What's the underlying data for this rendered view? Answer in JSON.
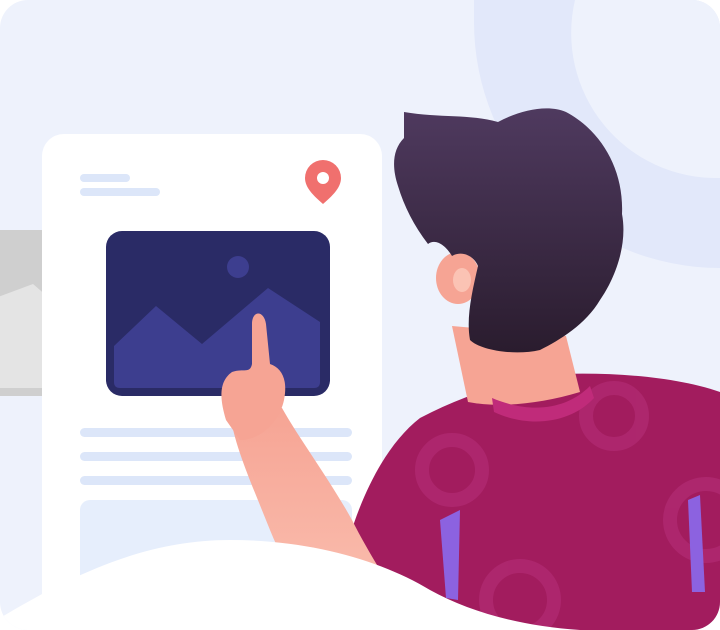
{
  "colors": {
    "background": "#EEF2FC",
    "decor_arc": "#E2E8FA",
    "card": "#FFFFFF",
    "placeholder_line": "#DCE6F9",
    "placeholder_block": "#E6EEFC",
    "side_card": "#CFCFCF",
    "side_card_icon": "#E4E4E4",
    "image_frame": "#2A2B66",
    "image_mountain": "#3D3E8F",
    "location_pin": "#F0706E",
    "skin": "#F6A494",
    "skin_light": "#FBC3B4",
    "hair_top": "#4F3A5F",
    "hair_bottom": "#2A1C2E",
    "shirt": "#A21C5E",
    "shirt_collar": "#C02B7A",
    "shirt_pattern": "#B6307A",
    "shirt_accent": "#8C62E0",
    "foreground_wave": "#FFFFFF"
  },
  "icons": {
    "location": "location-pin-icon",
    "image": "image-placeholder-icon"
  }
}
